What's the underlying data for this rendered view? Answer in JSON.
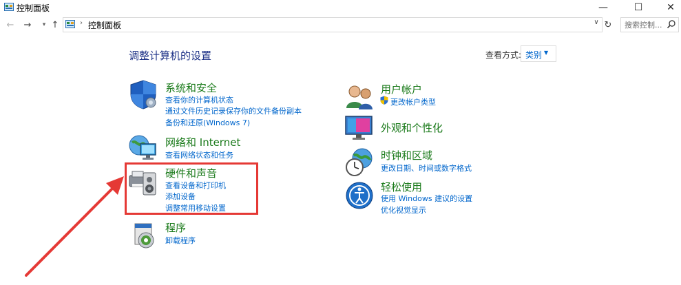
{
  "window": {
    "title": "控制面板"
  },
  "address": {
    "path": "控制面板",
    "search_placeholder": "搜索控制..."
  },
  "header": {
    "title": "调整计算机的设置",
    "view_label": "查看方式:",
    "view_value": "类别"
  },
  "categories": [
    {
      "title": "系统和安全",
      "links": [
        "查看你的计算机状态",
        "通过文件历史记录保存你的文件备份副本",
        "备份和还原(Windows 7)"
      ]
    },
    {
      "title": "网络和 Internet",
      "links": [
        "查看网络状态和任务"
      ]
    },
    {
      "title": "硬件和声音",
      "links": [
        "查看设备和打印机",
        "添加设备",
        "调整常用移动设置"
      ]
    },
    {
      "title": "程序",
      "links": [
        "卸载程序"
      ]
    },
    {
      "title": "用户帐户",
      "links": [
        "更改帐户类型"
      ]
    },
    {
      "title": "外观和个性化",
      "links": []
    },
    {
      "title": "时钟和区域",
      "links": [
        "更改日期、时间或数字格式"
      ]
    },
    {
      "title": "轻松使用",
      "links": [
        "使用 Windows 建议的设置",
        "优化视觉显示"
      ]
    }
  ],
  "colors": {
    "accent_link": "#0066cc",
    "category_title": "#1a7a1a",
    "annotation": "#e53935"
  }
}
